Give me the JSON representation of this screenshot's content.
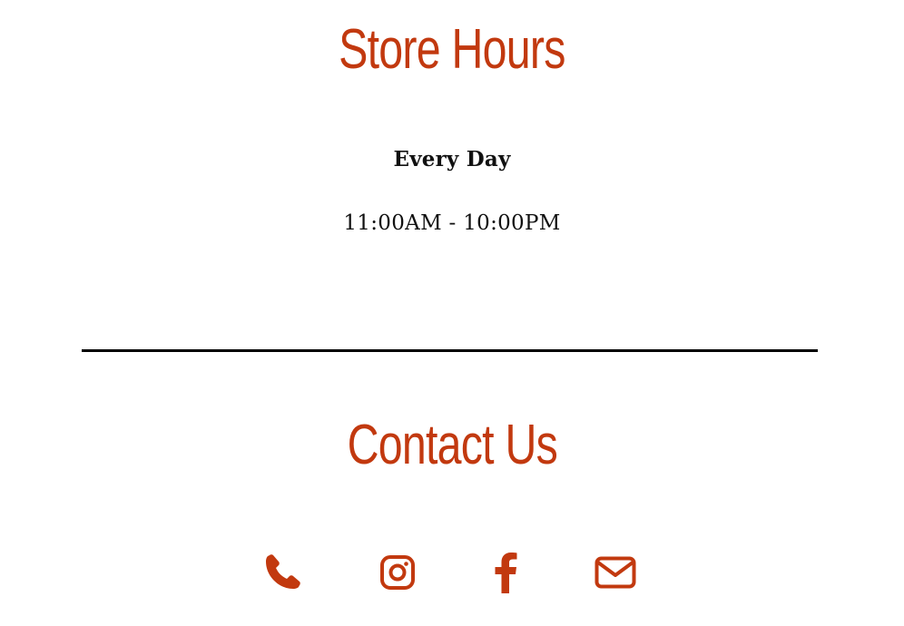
{
  "store_hours": {
    "title": "Store Hours",
    "day_label": "Every Day",
    "time_range": "11:00AM - 10:00PM"
  },
  "contact": {
    "title": "Contact Us",
    "icons": [
      "phone-icon",
      "instagram-icon",
      "facebook-icon",
      "email-icon"
    ]
  },
  "colors": {
    "accent": "#c2390f",
    "text": "#111111",
    "divider": "#000000",
    "background": "#ffffff"
  }
}
